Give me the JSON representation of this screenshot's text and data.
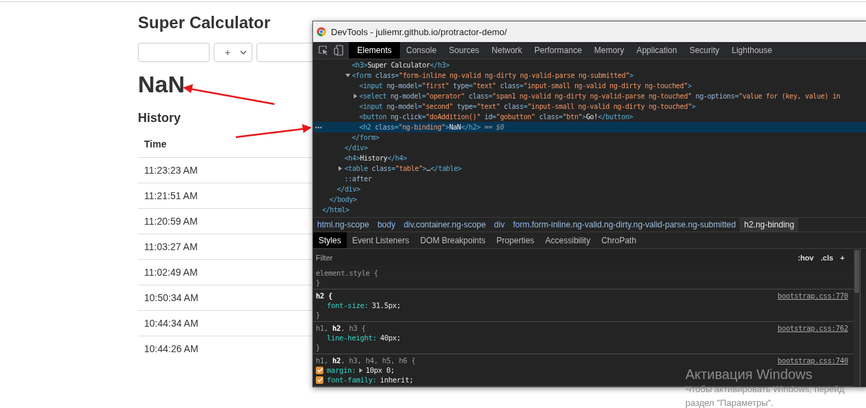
{
  "page": {
    "title": "Super Calculator",
    "inputs": [
      {
        "kind": "text"
      },
      {
        "kind": "select",
        "value": "+"
      },
      {
        "kind": "text"
      }
    ],
    "result": "NaN",
    "history_title": "History",
    "table": {
      "columns": [
        "Time"
      ],
      "rows": [
        "11:23:23 AM",
        "11:21:51 AM",
        "11:20:59 AM",
        "11:03:27 AM",
        "11:02:49 AM",
        "10:50:34 AM",
        "10:44:34 AM",
        "10:44:26 AM"
      ]
    }
  },
  "devtools": {
    "title": "DevTools - juliemr.github.io/protractor-demo/",
    "tabs": [
      {
        "label": "Elements",
        "selected": true
      },
      {
        "label": "Console",
        "selected": false
      },
      {
        "label": "Sources",
        "selected": false
      },
      {
        "label": "Network",
        "selected": false
      },
      {
        "label": "Performance",
        "selected": false
      },
      {
        "label": "Memory",
        "selected": false
      },
      {
        "label": "Application",
        "selected": false
      },
      {
        "label": "Security",
        "selected": false
      },
      {
        "label": "Lighthouse",
        "selected": false
      }
    ],
    "dom": [
      {
        "closing": [
          {
            "kind": "tag",
            "text": "</html>"
          }
        ],
        "children": [
          {
            "closing": [
              {
                "kind": "tag",
                "text": "</body>"
              }
            ],
            "children": [
              {
                "closing": [
                  {
                    "kind": "tag",
                    "text": "</div>"
                  }
                ],
                "children": [
                  {
                    "closing": [
                      {
                        "kind": "tag",
                        "text": "</div>"
                      }
                    ],
                    "children": [
                      {
                        "selected": false,
                        "segments": [
                          {
                            "kind": "tag",
                            "text": "<h3>"
                          },
                          {
                            "kind": "text",
                            "text": "Super Calculator"
                          },
                          {
                            "kind": "tag",
                            "text": "</h3>"
                          }
                        ]
                      },
                      {
                        "selected": false,
                        "expanded": true,
                        "segments": [
                          {
                            "kind": "tag",
                            "text": "<form "
                          },
                          {
                            "kind": "attr",
                            "text": "class"
                          },
                          {
                            "kind": "tag",
                            "text": "="
                          },
                          {
                            "kind": "value",
                            "text": "\"form-inline ng-valid ng-dirty ng-valid-parse ng-submitted\""
                          },
                          {
                            "kind": "tag",
                            "text": ">"
                          }
                        ],
                        "closing": [
                          {
                            "kind": "tag",
                            "text": "</form>"
                          }
                        ],
                        "children": [
                          {
                            "selected": false,
                            "segments": [
                              {
                                "kind": "tag",
                                "text": "<input "
                              },
                              {
                                "kind": "attr",
                                "text": "ng-model"
                              },
                              {
                                "kind": "tag",
                                "text": "="
                              },
                              {
                                "kind": "value",
                                "text": "\"first\""
                              },
                              {
                                "kind": "attr",
                                "text": " type"
                              },
                              {
                                "kind": "tag",
                                "text": "="
                              },
                              {
                                "kind": "value",
                                "text": "\"text\""
                              },
                              {
                                "kind": "attr",
                                "text": " class"
                              },
                              {
                                "kind": "tag",
                                "text": "="
                              },
                              {
                                "kind": "value",
                                "text": "\"input-small ng-valid ng-dirty ng-touched\""
                              },
                              {
                                "kind": "tag",
                                "text": ">"
                              }
                            ]
                          },
                          {
                            "selected": false,
                            "expanded": false,
                            "segments": [
                              {
                                "kind": "tag",
                                "text": "<select "
                              },
                              {
                                "kind": "attr",
                                "text": "ng-model"
                              },
                              {
                                "kind": "tag",
                                "text": "="
                              },
                              {
                                "kind": "value",
                                "text": "\"operator\""
                              },
                              {
                                "kind": "attr",
                                "text": " class"
                              },
                              {
                                "kind": "tag",
                                "text": "="
                              },
                              {
                                "kind": "value",
                                "text": "\"span1 ng-valid ng-dirty ng-valid-parse ng-touched\""
                              },
                              {
                                "kind": "attr",
                                "text": " ng-options"
                              },
                              {
                                "kind": "tag",
                                "text": "="
                              },
                              {
                                "kind": "value",
                                "text": "\"value for (key, value) in"
                              }
                            ]
                          },
                          {
                            "selected": false,
                            "segments": [
                              {
                                "kind": "tag",
                                "text": "<input "
                              },
                              {
                                "kind": "attr",
                                "text": "ng-model"
                              },
                              {
                                "kind": "tag",
                                "text": "="
                              },
                              {
                                "kind": "value",
                                "text": "\"second\""
                              },
                              {
                                "kind": "attr",
                                "text": " type"
                              },
                              {
                                "kind": "tag",
                                "text": "="
                              },
                              {
                                "kind": "value",
                                "text": "\"text\""
                              },
                              {
                                "kind": "attr",
                                "text": " class"
                              },
                              {
                                "kind": "tag",
                                "text": "="
                              },
                              {
                                "kind": "value",
                                "text": "\"input-small ng-valid ng-dirty ng-touched\""
                              },
                              {
                                "kind": "tag",
                                "text": ">"
                              }
                            ]
                          },
                          {
                            "selected": false,
                            "segments": [
                              {
                                "kind": "tag",
                                "text": "<button "
                              },
                              {
                                "kind": "attr",
                                "text": "ng-click"
                              },
                              {
                                "kind": "tag",
                                "text": "="
                              },
                              {
                                "kind": "value",
                                "text": "\"doAddition()\""
                              },
                              {
                                "kind": "attr",
                                "text": " id"
                              },
                              {
                                "kind": "tag",
                                "text": "="
                              },
                              {
                                "kind": "value",
                                "text": "\"gobutton\""
                              },
                              {
                                "kind": "attr",
                                "text": " class"
                              },
                              {
                                "kind": "tag",
                                "text": "="
                              },
                              {
                                "kind": "value",
                                "text": "\"btn\""
                              },
                              {
                                "kind": "tag",
                                "text": ">"
                              },
                              {
                                "kind": "text",
                                "text": "Go!"
                              },
                              {
                                "kind": "tag",
                                "text": "</button>"
                              }
                            ]
                          },
                          {
                            "selected": true,
                            "segments": [
                              {
                                "kind": "tag",
                                "text": "<h2 "
                              },
                              {
                                "kind": "attr",
                                "text": "class"
                              },
                              {
                                "kind": "tag",
                                "text": "="
                              },
                              {
                                "kind": "value",
                                "text": "\"ng-binding\""
                              },
                              {
                                "kind": "tag",
                                "text": ">"
                              },
                              {
                                "kind": "text",
                                "text": "NaN"
                              },
                              {
                                "kind": "tag",
                                "text": "</h2>"
                              },
                              {
                                "kind": "hint",
                                "text": " == $0"
                              }
                            ]
                          }
                        ]
                      }
                    ]
                  },
                  {
                    "selected": false,
                    "segments": [
                      {
                        "kind": "tag",
                        "text": "<h4>"
                      },
                      {
                        "kind": "text",
                        "text": "History"
                      },
                      {
                        "kind": "tag",
                        "text": "</h4>"
                      }
                    ]
                  },
                  {
                    "selected": false,
                    "expanded": false,
                    "segments": [
                      {
                        "kind": "tag",
                        "text": "<table "
                      },
                      {
                        "kind": "attr",
                        "text": "class"
                      },
                      {
                        "kind": "tag",
                        "text": "="
                      },
                      {
                        "kind": "value",
                        "text": "\"table\""
                      },
                      {
                        "kind": "tag",
                        "text": ">"
                      },
                      {
                        "kind": "text",
                        "text": "…"
                      },
                      {
                        "kind": "tag",
                        "text": "</table>"
                      }
                    ]
                  },
                  {
                    "selected": false,
                    "segments": [
                      {
                        "kind": "pseudo",
                        "text": "::after"
                      }
                    ]
                  }
                ]
              }
            ]
          }
        ]
      }
    ],
    "breadcrumbs": [
      {
        "tag": "html",
        "rest": ".ng-scope",
        "selected": false
      },
      {
        "tag": "body",
        "selected": false
      },
      {
        "tag": "div",
        "rest": ".container.ng-scope",
        "selected": false
      },
      {
        "tag": "div",
        "selected": false
      },
      {
        "tag": "form",
        "rest": ".form-inline.ng-valid.ng-dirty.ng-valid-parse.ng-submitted",
        "selected": false
      },
      {
        "tag": "h2",
        "rest": ".ng-binding",
        "selected": true
      }
    ],
    "subtabs": [
      {
        "label": "Styles",
        "selected": true
      },
      {
        "label": "Event Listeners",
        "selected": false
      },
      {
        "label": "DOM Breakpoints",
        "selected": false
      },
      {
        "label": "Properties",
        "selected": false
      },
      {
        "label": "Accessibility",
        "selected": false
      },
      {
        "label": "ChroPath",
        "selected": false
      }
    ],
    "filter": {
      "placeholder": "Filter"
    },
    "filter_buttons": [
      ":hov",
      ".cls",
      "+"
    ],
    "rules": [
      {
        "selector": "element.style {",
        "matched": false,
        "close": "}"
      },
      {
        "selector": "h2 {",
        "matched": true,
        "source": "bootstrap.css:770",
        "declarations": [
          {
            "property": "font-size:",
            "value": "31.5px;"
          }
        ],
        "close": "}"
      },
      {
        "selector": "h1, **h2**, h3 {",
        "matched": false,
        "source": "bootstrap.css:762",
        "declarations": [
          {
            "property": "line-height:",
            "value": "40px;"
          }
        ],
        "close": "}"
      },
      {
        "selector": "h1, **h2**, h3, h4, h5, h6 {",
        "matched": false,
        "source": "bootstrap.css:740",
        "declarations": [
          {
            "property": "margin:",
            "value": "10px 0;",
            "checked": true,
            "expandable": true
          },
          {
            "property": "font-family:",
            "value": "inherit;",
            "checked": true
          }
        ]
      }
    ]
  },
  "os_watermark": [
    "Активация Windows",
    "Чтобы активировать Windows, перейд",
    "раздел \"Параметры\"."
  ]
}
